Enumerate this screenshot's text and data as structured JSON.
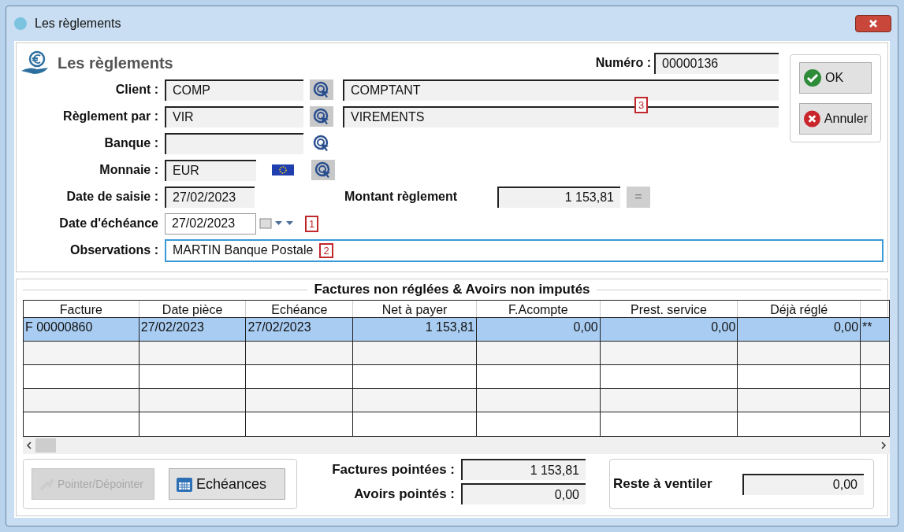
{
  "window": {
    "title": "Les règlements"
  },
  "header": {
    "title": "Les règlements",
    "number_label": "Numéro :",
    "number": "00000136"
  },
  "form": {
    "client": {
      "label": "Client :",
      "code": "COMP",
      "name": "COMPTANT"
    },
    "payment_by": {
      "label": "Règlement par :",
      "code": "VIR",
      "name": "VIREMENTS",
      "marker": "3"
    },
    "bank": {
      "label": "Banque :"
    },
    "currency": {
      "label": "Monnaie :",
      "code": "EUR"
    },
    "entry_date": {
      "label": "Date de saisie :",
      "value": "27/02/2023"
    },
    "amount": {
      "label": "Montant règlement",
      "value": "1 153,81",
      "button": "="
    },
    "due_date": {
      "label": "Date d'échéance",
      "value": "27/02/2023",
      "marker": "1"
    },
    "notes": {
      "label": "Observations :",
      "value": "MARTIN Banque Postale",
      "marker": "2",
      "focused": true
    }
  },
  "buttons": [
    {
      "kind": "ok",
      "label": "OK"
    },
    {
      "kind": "cancel",
      "label": "Annuler"
    }
  ],
  "table": {
    "title": "Factures non réglées & Avoirs non imputés",
    "columns": [
      "Facture",
      "Date pièce",
      "Echéance",
      "Net à payer",
      "F.Acompte",
      "Prest. service",
      "Déjà réglé"
    ],
    "rows": [
      {
        "selected": true,
        "cells": [
          "F 00000860",
          "27/02/2023",
          "27/02/2023",
          "1 153,81",
          "0,00",
          "0,00",
          "0,00",
          "**"
        ]
      }
    ]
  },
  "actions": [
    {
      "label": "Pointer/Dépointer",
      "disabled": true,
      "kind": "point"
    },
    {
      "label": "Echéances",
      "disabled": false,
      "kind": "calendar"
    }
  ],
  "totals": {
    "invoices_label": "Factures pointées :",
    "invoices": "1 153,81",
    "credits_label": "Avoirs pointés :",
    "credits": "0,00",
    "remaining_label": "Reste à ventiler",
    "remaining": "0,00"
  }
}
